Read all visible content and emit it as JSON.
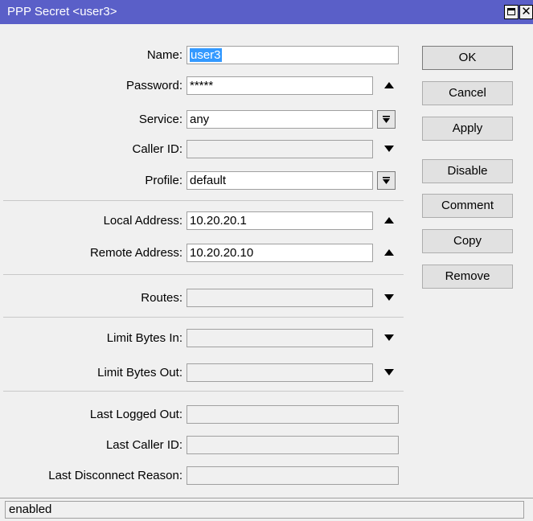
{
  "window": {
    "title": "PPP Secret <user3>",
    "close_glyph": "✕"
  },
  "form": {
    "name": {
      "label": "Name:",
      "value": "user3"
    },
    "password": {
      "label": "Password:",
      "value": "*****"
    },
    "service": {
      "label": "Service:",
      "value": "any"
    },
    "caller_id": {
      "label": "Caller ID:",
      "value": ""
    },
    "profile": {
      "label": "Profile:",
      "value": "default"
    },
    "local_address": {
      "label": "Local Address:",
      "value": "10.20.20.1"
    },
    "remote_address": {
      "label": "Remote Address:",
      "value": "10.20.20.10"
    },
    "routes": {
      "label": "Routes:",
      "value": ""
    },
    "limit_bytes_in": {
      "label": "Limit Bytes In:",
      "value": ""
    },
    "limit_bytes_out": {
      "label": "Limit Bytes Out:",
      "value": ""
    },
    "last_logged_out": {
      "label": "Last Logged Out:",
      "value": ""
    },
    "last_caller_id": {
      "label": "Last Caller ID:",
      "value": ""
    },
    "last_disconnect_reason": {
      "label": "Last Disconnect Reason:",
      "value": ""
    }
  },
  "buttons": {
    "ok": "OK",
    "cancel": "Cancel",
    "apply": "Apply",
    "disable": "Disable",
    "comment": "Comment",
    "copy": "Copy",
    "remove": "Remove"
  },
  "status": {
    "text": "enabled"
  },
  "icons": {
    "up_arrow": "triangle-up-icon",
    "down_arrow": "triangle-down-icon",
    "dropdown": "dropdown-icon",
    "maximize": "maximize-icon",
    "close": "close-icon"
  }
}
